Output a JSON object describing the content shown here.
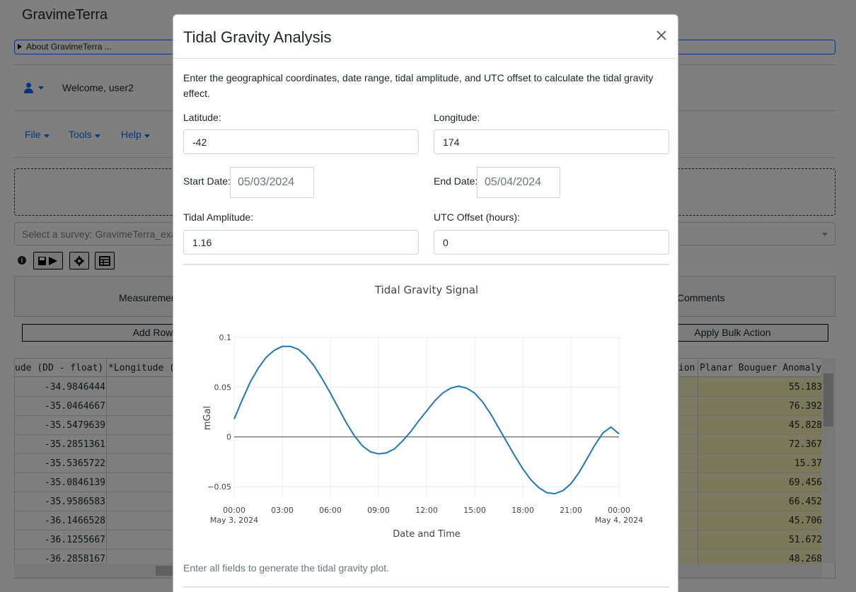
{
  "app": {
    "title": "GravimeTerra",
    "about_label": "About GravimeTerra ...",
    "welcome": "Welcome, user2",
    "menus": [
      "File",
      "Tools",
      "Help"
    ],
    "survey_placeholder": "Select a survey: GravimeTerra_exar",
    "tabs": [
      "Measuremen",
      "Comments"
    ],
    "add_row": "Add Row",
    "apply_bulk": "Apply Bulk Action",
    "grid": {
      "headers": [
        "ude (DD - float)",
        "*Longitude (",
        "ion",
        "Planar Bouguer Anomaly"
      ],
      "latitudes": [
        "-34.9846444",
        "-35.0464667",
        "-35.5479639",
        "-35.2851361",
        "-35.5365722",
        "-35.0846139",
        "-35.9586583",
        "-36.1466528",
        "-36.1255667",
        "-36.2858167"
      ],
      "anomalies": [
        "55.183",
        "76.392",
        "45.828",
        "72.367",
        "15.37",
        "69.456",
        "66.452",
        "45.706",
        "51.672",
        "48.268"
      ]
    }
  },
  "modal": {
    "title": "Tidal Gravity Analysis",
    "intro": "Enter the geographical coordinates, date range, tidal amplitude, and UTC offset to calculate the tidal gravity effect.",
    "latitude": {
      "label": "Latitude:",
      "value": "-42"
    },
    "longitude": {
      "label": "Longitude:",
      "value": "174"
    },
    "start_date": {
      "label": "Start Date:",
      "value": "05/03/2024"
    },
    "end_date": {
      "label": "End Date:",
      "value": "05/04/2024"
    },
    "amplitude": {
      "label": "Tidal Amplitude:",
      "value": "1.16"
    },
    "utc_offset": {
      "label": "UTC Offset (hours):",
      "value": "0"
    },
    "hint": "Enter all fields to generate the tidal gravity plot."
  },
  "chart_data": {
    "type": "line",
    "title": "Tidal Gravity Signal",
    "xlabel": "Date and Time",
    "ylabel": "mGal",
    "x_ticks": [
      {
        "hour": 0,
        "label": "00:00",
        "sub": "May 3, 2024"
      },
      {
        "hour": 3,
        "label": "03:00",
        "sub": ""
      },
      {
        "hour": 6,
        "label": "06:00",
        "sub": ""
      },
      {
        "hour": 9,
        "label": "09:00",
        "sub": ""
      },
      {
        "hour": 12,
        "label": "12:00",
        "sub": ""
      },
      {
        "hour": 15,
        "label": "15:00",
        "sub": ""
      },
      {
        "hour": 18,
        "label": "18:00",
        "sub": ""
      },
      {
        "hour": 21,
        "label": "21:00",
        "sub": ""
      },
      {
        "hour": 24,
        "label": "00:00",
        "sub": "May 4, 2024"
      }
    ],
    "y_ticks": [
      -0.05,
      0,
      0.05,
      0.1
    ],
    "ylim": [
      -0.062,
      0.1
    ],
    "xlim": [
      0,
      24
    ],
    "color": "#1f77b4",
    "series": [
      {
        "x": [
          0,
          0.5,
          1,
          1.5,
          2,
          2.5,
          3,
          3.5,
          4,
          4.5,
          5,
          5.5,
          6,
          6.5,
          7,
          7.5,
          8,
          8.5,
          9,
          9.5,
          10,
          10.5,
          11,
          11.5,
          12,
          12.5,
          13,
          13.5,
          14,
          14.5,
          15,
          15.5,
          16,
          16.5,
          17,
          17.5,
          18,
          18.5,
          19,
          19.5,
          20,
          20.5,
          21,
          21.5,
          22,
          22.5,
          23,
          23.5,
          24
        ],
        "y": [
          0.018,
          0.037,
          0.055,
          0.069,
          0.08,
          0.087,
          0.091,
          0.091,
          0.088,
          0.081,
          0.071,
          0.058,
          0.044,
          0.029,
          0.014,
          0.001,
          -0.009,
          -0.015,
          -0.017,
          -0.016,
          -0.012,
          -0.004,
          0.005,
          0.016,
          0.026,
          0.036,
          0.044,
          0.049,
          0.051,
          0.049,
          0.044,
          0.035,
          0.023,
          0.009,
          -0.005,
          -0.019,
          -0.032,
          -0.043,
          -0.051,
          -0.056,
          -0.057,
          -0.054,
          -0.047,
          -0.036,
          -0.022,
          -0.008,
          0.004,
          0.01,
          0.003
        ]
      }
    ]
  }
}
